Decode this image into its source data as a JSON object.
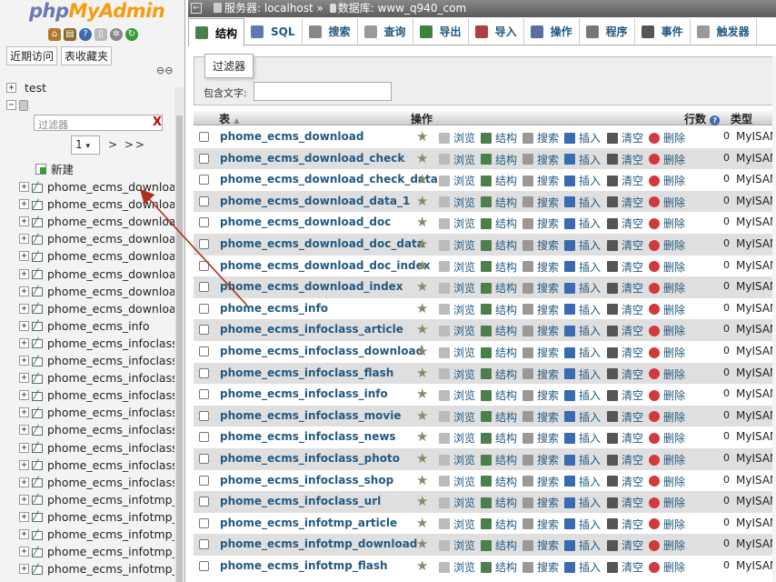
{
  "nav": {
    "logo_php": "php",
    "logo_my": "MyAdmin",
    "tab_recent": "近期访问",
    "tab_favorites": "表收藏夹",
    "collapse_link": "⊖⊖",
    "db_test": "test",
    "filter_placeholder": "过滤器",
    "filter_clear": "X",
    "page_value": "1",
    "page_next": "> >>",
    "new_label": "新建",
    "tables": [
      "phome_ecms_download",
      "phome_ecms_download_",
      "phome_ecms_download_",
      "phome_ecms_download_",
      "phome_ecms_download_",
      "phome_ecms_download_",
      "phome_ecms_download_",
      "phome_ecms_download_",
      "phome_ecms_info",
      "phome_ecms_infoclass_a",
      "phome_ecms_infoclass_d",
      "phome_ecms_infoclass_fl",
      "phome_ecms_infoclass_ir",
      "phome_ecms_infoclass_m",
      "phome_ecms_infoclass_n",
      "phome_ecms_infoclass_p",
      "phome_ecms_infoclass_s",
      "phome_ecms_infoclass_u",
      "phome_ecms_infotmp_ar",
      "phome_ecms_infotmp_do",
      "phome_ecms_infotmp_fla",
      "phome_ecms_infotmp_in",
      "phome_ecms_infotmp_m"
    ]
  },
  "breadcrumb": {
    "server": "服务器: localhost »",
    "database": "数据库: www_q940_com"
  },
  "tabs": [
    {
      "label": "结构",
      "color": "#4c7f4c"
    },
    {
      "label": "SQL",
      "color": "#5a7ab0"
    },
    {
      "label": "搜索",
      "color": "#888888"
    },
    {
      "label": "查询",
      "color": "#999999"
    },
    {
      "label": "导出",
      "color": "#3f7f3f"
    },
    {
      "label": "导入",
      "color": "#b04040"
    },
    {
      "label": "操作",
      "color": "#5a6f9a"
    },
    {
      "label": "程序",
      "color": "#777777"
    },
    {
      "label": "事件",
      "color": "#555555"
    },
    {
      "label": "触发器",
      "color": "#999999"
    }
  ],
  "filter": {
    "legend": "过滤器",
    "contains_label": "包含文字:",
    "contains_value": ""
  },
  "table_header": {
    "table": "表",
    "sort_mark": "▲",
    "action": "操作",
    "rows": "行数",
    "type": "类型"
  },
  "actions": {
    "browse": "浏览",
    "structure": "结构",
    "search": "搜索",
    "insert": "插入",
    "empty": "清空",
    "drop": "删除"
  },
  "rows": [
    {
      "name": "phome_ecms_download",
      "rows": "0",
      "engine": "MyISAM"
    },
    {
      "name": "phome_ecms_download_check",
      "rows": "0",
      "engine": "MyISAM"
    },
    {
      "name": "phome_ecms_download_check_data",
      "rows": "0",
      "engine": "MyISAM"
    },
    {
      "name": "phome_ecms_download_data_1",
      "rows": "0",
      "engine": "MyISAM"
    },
    {
      "name": "phome_ecms_download_doc",
      "rows": "0",
      "engine": "MyISAM"
    },
    {
      "name": "phome_ecms_download_doc_data",
      "rows": "0",
      "engine": "MyISAM"
    },
    {
      "name": "phome_ecms_download_doc_index",
      "rows": "0",
      "engine": "MyISAM"
    },
    {
      "name": "phome_ecms_download_index",
      "rows": "0",
      "engine": "MyISAM"
    },
    {
      "name": "phome_ecms_info",
      "rows": "0",
      "engine": "MyISAM"
    },
    {
      "name": "phome_ecms_infoclass_article",
      "rows": "0",
      "engine": "MyISAM"
    },
    {
      "name": "phome_ecms_infoclass_download",
      "rows": "0",
      "engine": "MyISAM"
    },
    {
      "name": "phome_ecms_infoclass_flash",
      "rows": "0",
      "engine": "MyISAM"
    },
    {
      "name": "phome_ecms_infoclass_info",
      "rows": "0",
      "engine": "MyISAM"
    },
    {
      "name": "phome_ecms_infoclass_movie",
      "rows": "0",
      "engine": "MyISAM"
    },
    {
      "name": "phome_ecms_infoclass_news",
      "rows": "0",
      "engine": "MyISAM"
    },
    {
      "name": "phome_ecms_infoclass_photo",
      "rows": "0",
      "engine": "MyISAM"
    },
    {
      "name": "phome_ecms_infoclass_shop",
      "rows": "0",
      "engine": "MyISAM"
    },
    {
      "name": "phome_ecms_infoclass_url",
      "rows": "0",
      "engine": "MyISAM"
    },
    {
      "name": "phome_ecms_infotmp_article",
      "rows": "0",
      "engine": "MyISAM"
    },
    {
      "name": "phome_ecms_infotmp_download",
      "rows": "0",
      "engine": "MyISAM"
    },
    {
      "name": "phome_ecms_infotmp_flash",
      "rows": "0",
      "engine": "MyISAM"
    }
  ],
  "colors": {
    "link": "#235a81",
    "arrow": "#b03020",
    "logo_orange": "#f89c0e",
    "logo_blue": "#6c78af"
  }
}
